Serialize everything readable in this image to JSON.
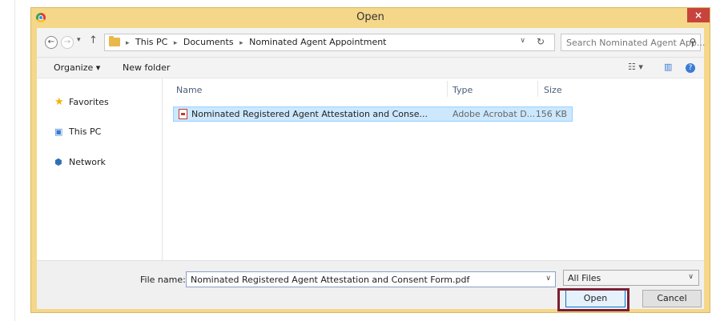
{
  "window": {
    "title": "Open",
    "close_glyph": "×"
  },
  "address_bar": {
    "crumbs": [
      "This PC",
      "Documents",
      "Nominated Agent Appointment"
    ],
    "separator": "▸"
  },
  "search": {
    "placeholder": "Search Nominated Agent App..."
  },
  "toolbar": {
    "organize": "Organize ▾",
    "new_folder": "New folder"
  },
  "nav_pane": {
    "favorites": "Favorites",
    "this_pc": "This PC",
    "network": "Network"
  },
  "columns": {
    "name": "Name",
    "type": "Type",
    "size": "Size"
  },
  "files": [
    {
      "name": "Nominated Registered Agent Attestation and Conse...",
      "type": "Adobe Acrobat D...",
      "size": "156 KB",
      "selected": true
    }
  ],
  "bottom": {
    "file_name_label": "File name:",
    "file_name_value": "Nominated Registered Agent Attestation and Consent Form.pdf",
    "file_type": "All Files",
    "open_label": "Open",
    "cancel_label": "Cancel"
  },
  "colors": {
    "title_bar": "#f5d78a",
    "close": "#c7433c",
    "selection": "#cce8ff",
    "highlight_box": "#7a1f34"
  },
  "icons": {
    "back": "arrow-left-icon",
    "forward": "arrow-right-icon",
    "up": "arrow-up-icon",
    "folder": "folder-icon",
    "refresh": "refresh-icon",
    "search": "search-icon",
    "view": "view-options-icon",
    "preview": "preview-pane-icon",
    "help": "help-icon",
    "favorites": "star-icon",
    "this_pc": "computer-icon",
    "network": "network-icon",
    "file": "pdf-icon"
  }
}
